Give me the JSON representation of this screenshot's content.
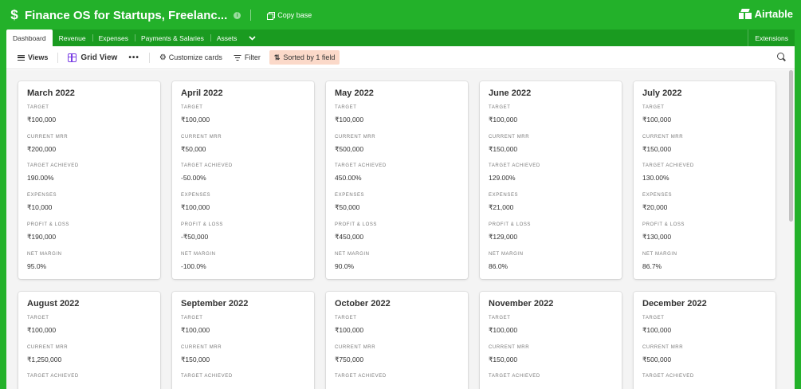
{
  "app": {
    "title": "Finance OS for Startups, Freelanc...",
    "base_icon": "dollar-icon",
    "copy_label": "Copy base",
    "brand": "Airtable"
  },
  "tabs": [
    {
      "label": "Dashboard",
      "active": true
    },
    {
      "label": "Revenue",
      "active": false
    },
    {
      "label": "Expenses",
      "active": false
    },
    {
      "label": "Payments & Salaries",
      "active": false
    },
    {
      "label": "Assets",
      "active": false
    }
  ],
  "extensions_label": "Extensions",
  "toolbar": {
    "views_label": "Views",
    "view_name": "Grid View",
    "more_label": "•••",
    "customize_label": "Customize cards",
    "filter_label": "Filter",
    "sort_label": "Sorted by 1 field"
  },
  "colors": {
    "brand_green": "#23b12a",
    "tab_bar_green": "#1a9b20",
    "sort_highlight": "#fbd9c9",
    "grid_icon": "#7a3fe4"
  },
  "fields": [
    "TARGET",
    "CURRENT MRR",
    "TARGET ACHIEVED",
    "EXPENSES",
    "PROFIT & LOSS",
    "NET MARGIN"
  ],
  "cards": [
    {
      "title": "March 2022",
      "values": [
        "₹100,000",
        "₹200,000",
        "190.00%",
        "₹10,000",
        "₹190,000",
        "95.0%"
      ]
    },
    {
      "title": "April 2022",
      "values": [
        "₹100,000",
        "₹50,000",
        "-50.00%",
        "₹100,000",
        "-₹50,000",
        "-100.0%"
      ]
    },
    {
      "title": "May 2022",
      "values": [
        "₹100,000",
        "₹500,000",
        "450.00%",
        "₹50,000",
        "₹450,000",
        "90.0%"
      ]
    },
    {
      "title": "June 2022",
      "values": [
        "₹100,000",
        "₹150,000",
        "129.00%",
        "₹21,000",
        "₹129,000",
        "86.0%"
      ]
    },
    {
      "title": "July 2022",
      "values": [
        "₹100,000",
        "₹150,000",
        "130.00%",
        "₹20,000",
        "₹130,000",
        "86.7%"
      ]
    },
    {
      "title": "August 2022",
      "values": [
        "₹100,000",
        "₹1,250,000"
      ]
    },
    {
      "title": "September 2022",
      "values": [
        "₹100,000",
        "₹150,000"
      ]
    },
    {
      "title": "October 2022",
      "values": [
        "₹100,000",
        "₹750,000"
      ]
    },
    {
      "title": "November 2022",
      "values": [
        "₹100,000",
        "₹150,000"
      ]
    },
    {
      "title": "December 2022",
      "values": [
        "₹100,000",
        "₹500,000"
      ]
    }
  ]
}
